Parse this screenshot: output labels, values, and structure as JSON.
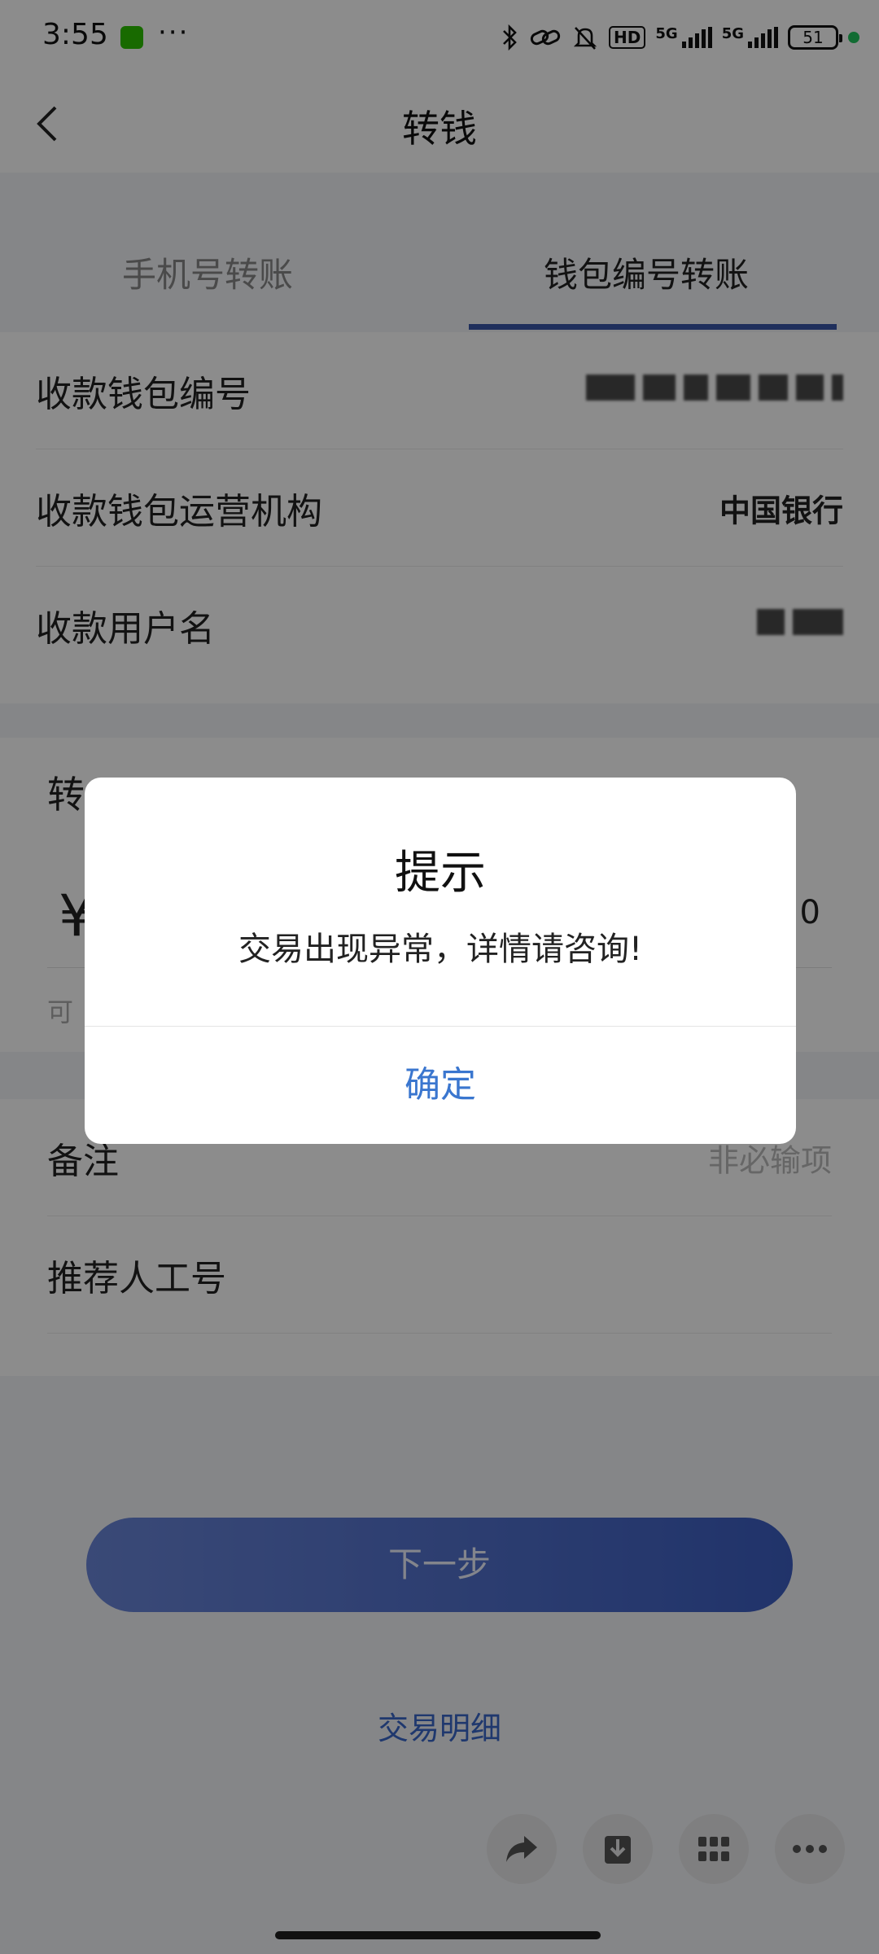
{
  "status_bar": {
    "time": "3:55",
    "dots": "···",
    "network_5g_1": "5G",
    "network_5g_2": "5G",
    "hd_label": "HD",
    "battery": "51"
  },
  "nav": {
    "title": "转钱"
  },
  "tabs": {
    "phone_transfer": "手机号转账",
    "wallet_transfer": "钱包编号转账",
    "active": "wallet_transfer"
  },
  "form": {
    "wallet_id_label": "收款钱包编号",
    "operator_label": "收款钱包运营机构",
    "operator_value": "中国银行",
    "username_label": "收款用户名",
    "amount_label_partial": "转",
    "amount_currency": "¥",
    "amount_trailing": "0",
    "available_partial": "可",
    "remark_label": "备注",
    "remark_placeholder": "非必输项",
    "referrer_label": "推荐人工号"
  },
  "actions": {
    "next_button": "下一步",
    "transaction_details": "交易明细"
  },
  "dialog": {
    "title": "提示",
    "message": "交易出现异常，详情请咨询!",
    "confirm": "确定"
  },
  "colors": {
    "accent": "#3a56a8",
    "dialog_confirm": "#3a76cf",
    "link": "#3a67c9"
  },
  "icons": {
    "back": "back-chevron-icon",
    "bluetooth": "bluetooth-icon",
    "nfc": "nfc-link-icon",
    "mute": "bell-mute-icon",
    "share": "share-icon",
    "download": "download-icon",
    "apps": "grid-icon",
    "more": "more-icon"
  }
}
